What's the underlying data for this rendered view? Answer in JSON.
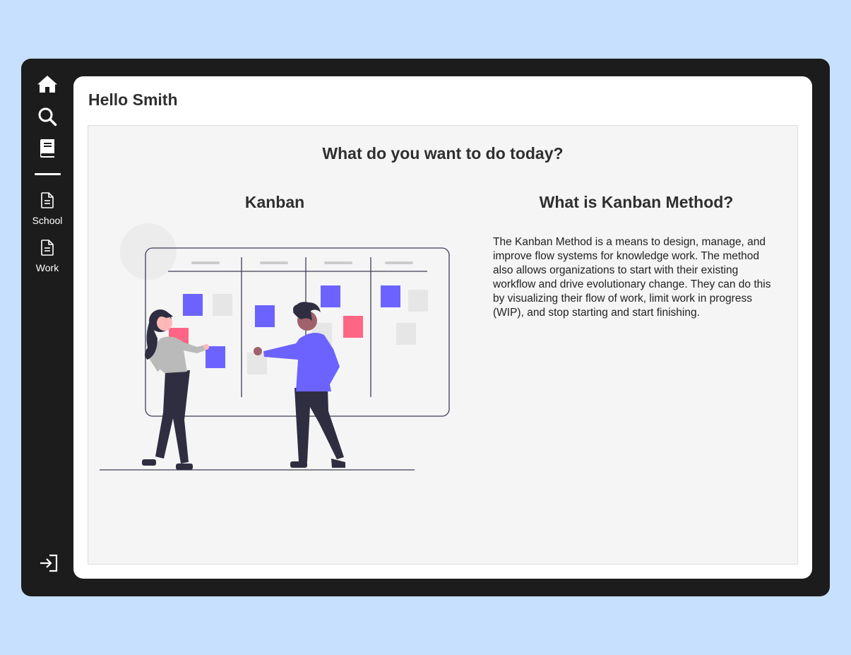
{
  "sidebar": {
    "icons": {
      "home": "home-icon",
      "search": "search-icon",
      "book": "book-icon",
      "logout": "logout-icon"
    },
    "items": [
      {
        "label": "School",
        "icon": "document-icon"
      },
      {
        "label": "Work",
        "icon": "document-icon"
      }
    ]
  },
  "header": {
    "greeting": "Hello Smith"
  },
  "main": {
    "heading": "What do you want to do today?",
    "kanban_title": "Kanban",
    "method_title": "What is Kanban Method?",
    "method_description": "The Kanban Method is a means to design, manage, and improve flow systems for knowledge work. The method also allows organizations to start with their existing workflow and drive evolutionary change. They can do this by visualizing their flow of work, limit work in progress (WIP), and stop starting and start finishing."
  },
  "colors": {
    "background": "#c6e0fd",
    "frame": "#1c1c1c",
    "accent_purple": "#6c63ff",
    "accent_pink": "#ff6584",
    "card_gray": "#e6e6e6"
  }
}
